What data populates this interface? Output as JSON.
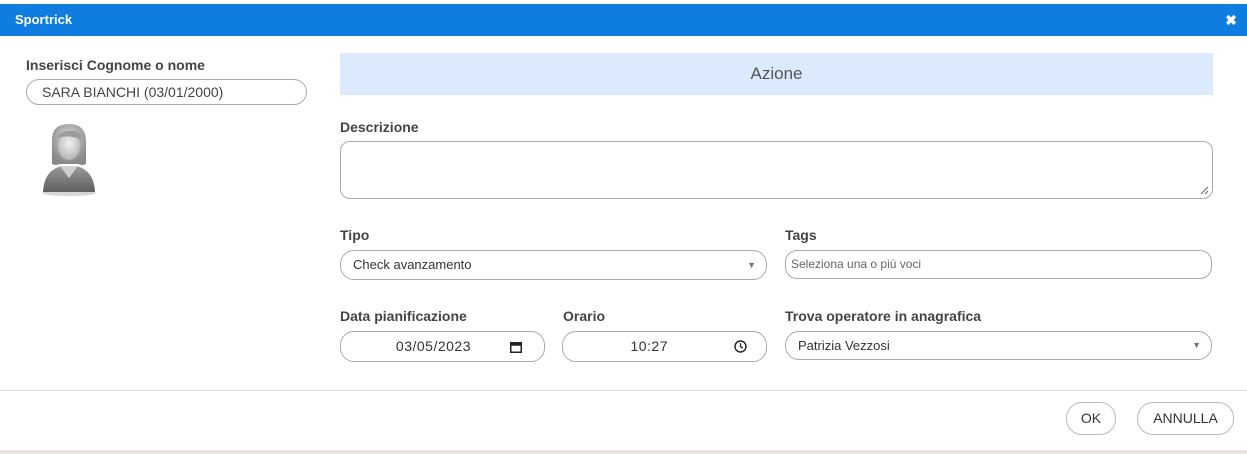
{
  "window": {
    "title": "Sportrick",
    "close_glyph": "✖",
    "title_bar_color": "#0f7ddf"
  },
  "left_panel": {
    "search_label": "Inserisci Cognome o nome",
    "search_value": "SARA BIANCHI (03/01/2000)",
    "avatar_icon": "female-user-avatar-icon"
  },
  "form": {
    "section_header": "Azione",
    "section_header_color": "#dbeafc",
    "description_label": "Descrizione",
    "description_value": "",
    "type_label": "Tipo",
    "type_value": "Check avanzamento",
    "tags_label": "Tags",
    "tags_placeholder": "Seleziona una o più voci",
    "date_label": "Data pianificazione",
    "date_value": "03/05/2023",
    "time_label": "Orario",
    "time_value": "10:27",
    "operator_label": "Trova operatore in anagrafica",
    "operator_value": "Patrizia Vezzosi",
    "dropdown_arrow": "▼"
  },
  "footer": {
    "ok_label": "OK",
    "cancel_label": "ANNULLA"
  }
}
